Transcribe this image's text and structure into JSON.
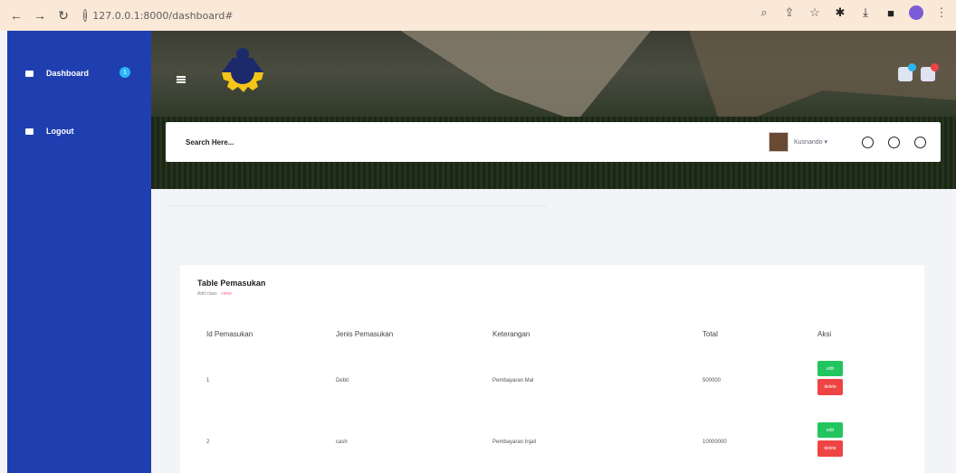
{
  "browser": {
    "url": "127.0.0.1:8000/dashboard#"
  },
  "sidebar": {
    "items": [
      {
        "label": "Dashboard",
        "badge": "1"
      },
      {
        "label": "Logout"
      }
    ]
  },
  "header": {
    "search_placeholder": "Search Here...",
    "user_name": "Kusnando"
  },
  "table": {
    "title": "Table Pemasukan",
    "subtitle": "Add class",
    "subtitle_link": "+new",
    "columns": [
      "Id Pemasukan",
      "Jenis Pemasukan",
      "Keterangan",
      "Total",
      "Aksi"
    ],
    "rows": [
      {
        "id": "1",
        "jenis": "Debit",
        "keterangan": "Pembayaran Mal",
        "total": "500000",
        "edit": "edit",
        "delete": "delete"
      },
      {
        "id": "2",
        "jenis": "cash",
        "keterangan": "Pembayaran Injail",
        "total": "10000000",
        "edit": "edit",
        "delete": "delete"
      }
    ]
  },
  "colors": {
    "sidebar": "#1f3fb0",
    "edit": "#22c55e",
    "delete": "#ef4444",
    "badge": "#29b6f6"
  }
}
